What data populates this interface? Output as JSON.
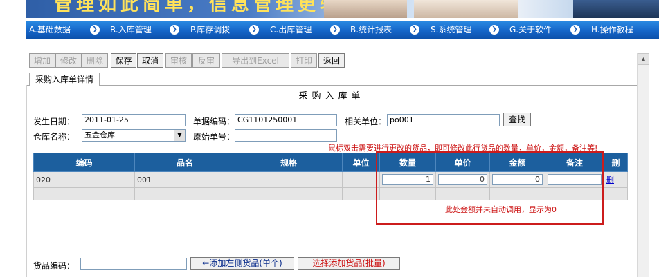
{
  "banner": {
    "slogan": "管理如此简单，信息管理更轻松！"
  },
  "menu": [
    {
      "label": "A.基础数据"
    },
    {
      "label": "R.入库管理"
    },
    {
      "label": "P.库存调拨"
    },
    {
      "label": "C.出库管理"
    },
    {
      "label": "B.统计报表"
    },
    {
      "label": "S.系统管理"
    },
    {
      "label": "G.关于软件"
    },
    {
      "label": "H.操作教程"
    }
  ],
  "toolbar": {
    "add": "增加",
    "edit": "修改",
    "delete": "删除",
    "save": "保存",
    "cancel": "取消",
    "audit": "审核",
    "unaudit": "反审",
    "export": "导出到Excel",
    "print": "打印",
    "back": "返回"
  },
  "tab": {
    "label": "采购入库单详情"
  },
  "form": {
    "title": "采购入库单",
    "date_label": "发生日期：",
    "date_value": "2011-01-25",
    "code_label": "单据编码：",
    "code_value": "CG1101250001",
    "unit_label": "相关单位：",
    "unit_value": "po001",
    "find_button": "查找",
    "warehouse_label": "仓库名称：",
    "warehouse_value": "五金仓库",
    "orig_label": "原始单号：",
    "orig_value": ""
  },
  "hint": "鼠标双击需要进行更改的货品，即可修改此行货品的数量，单价，金额，备注等!",
  "grid": {
    "headers": [
      "编码",
      "品名",
      "规格",
      "单位",
      "数量",
      "单价",
      "金额",
      "备注",
      "删"
    ],
    "row": {
      "code": "020",
      "name": "001",
      "spec": "",
      "unit": "",
      "qty": "1",
      "price": "0",
      "amount": "0",
      "remark": "",
      "delete": "删"
    }
  },
  "annotation": "此处金额并未自动调用，显示为0",
  "bottom": {
    "goods_code_label": "货品编码：",
    "add_left": "←添加左侧货品(单个)",
    "add_batch": "选择添加货品(批量)"
  },
  "colors": {
    "menu_bar": "#1565c8",
    "grid_header": "#1c5f9e",
    "annotation": "#cc1c1c"
  }
}
